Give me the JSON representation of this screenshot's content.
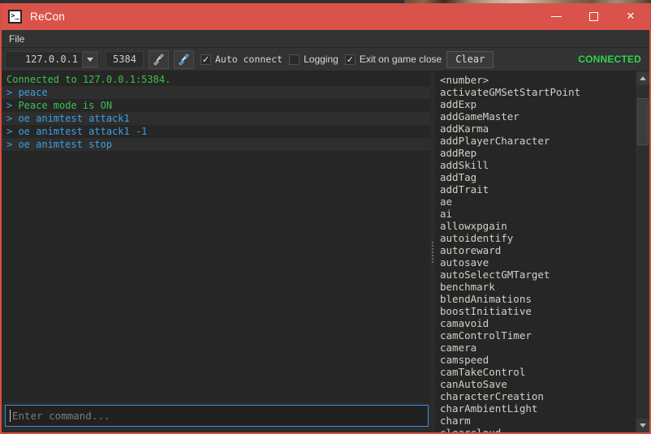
{
  "window": {
    "title": "ReCon",
    "icon": "terminal-prompt-icon",
    "icon_glyph": ">_",
    "accent_color": "#d9534a",
    "controls": {
      "minimize": "minimize-icon",
      "maximize": "maximize-icon",
      "close": "close-icon",
      "close_glyph": "✕"
    }
  },
  "menubar": {
    "items": [
      {
        "label": "File"
      }
    ]
  },
  "toolbar": {
    "host": {
      "value": "127.0.0.1",
      "dropdown_icon": "chevron-down-icon"
    },
    "port": {
      "value": "5384"
    },
    "connect_button": {
      "icon": "plug-disconnect-icon",
      "enabled": false
    },
    "disconnect_button": {
      "icon": "plug-connect-icon",
      "enabled": true
    },
    "auto_connect": {
      "label": "Auto connect",
      "checked": true,
      "check_glyph": "✓"
    },
    "logging": {
      "label": "Logging",
      "checked": false,
      "check_glyph": ""
    },
    "exit_on_game_close": {
      "label": "Exit on game close",
      "checked": true,
      "check_glyph": "✓"
    },
    "clear_button": {
      "label": "Clear"
    },
    "status": {
      "text": "CONNECTED",
      "color": "#2fd24f"
    }
  },
  "console": {
    "lines": [
      {
        "text": "Connected to 127.0.0.1:5384.",
        "color": "green",
        "prompt": false
      },
      {
        "text": "peace",
        "color": "blue",
        "prompt": true
      },
      {
        "text": "Peace mode is ON",
        "color": "green",
        "prompt": true
      },
      {
        "text": "oe animtest attack1",
        "color": "blue",
        "prompt": true
      },
      {
        "text": "oe animtest attack1 -1",
        "color": "blue",
        "prompt": true
      },
      {
        "text": "oe animtest stop",
        "color": "blue",
        "prompt": true
      }
    ],
    "prompt_char": ">"
  },
  "command_input": {
    "value": "",
    "placeholder": "Enter command...",
    "focused": true
  },
  "command_list": {
    "items": [
      "<number>",
      "activateGMSetStartPoint",
      "addExp",
      "addGameMaster",
      "addKarma",
      "addPlayerCharacter",
      "addRep",
      "addSkill",
      "addTag",
      "addTrait",
      "ae",
      "ai",
      "allowxpgain",
      "autoidentify",
      "autoreward",
      "autosave",
      "autoSelectGMTarget",
      "benchmark",
      "blendAnimations",
      "boostInitiative",
      "camavoid",
      "camControlTimer",
      "camera",
      "camspeed",
      "camTakeControl",
      "canAutoSave",
      "characterCreation",
      "charAmbientLight",
      "charm",
      "clearcloud"
    ]
  },
  "scrollbar": {
    "up_icon": "scroll-up-arrow-icon",
    "down_icon": "scroll-down-arrow-icon",
    "thumb_position_pct": 4,
    "thumb_size_pct": 14
  },
  "splitter": {
    "grip_icon": "splitter-grip-icon"
  }
}
